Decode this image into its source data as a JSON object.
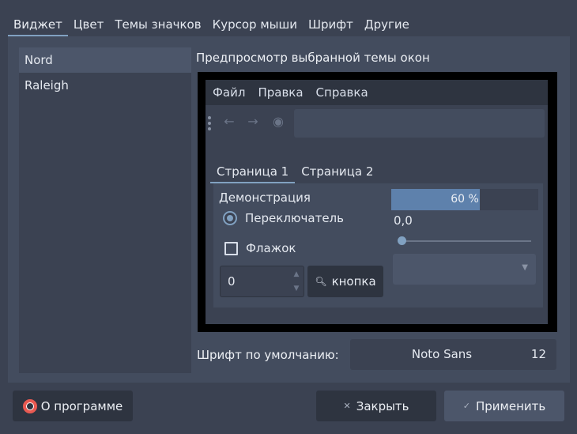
{
  "tabs": [
    "Виджет",
    "Цвет",
    "Темы значков",
    "Курсор мыши",
    "Шрифт",
    "Другие"
  ],
  "style_list": [
    "Nord",
    "Raleigh"
  ],
  "preview": {
    "label": "Предпросмотр выбранной темы окон",
    "menu": [
      "Файл",
      "Правка",
      "Справка"
    ],
    "toolbar_icons": [
      "back-arrow",
      "forward-arrow",
      "record"
    ],
    "tabs": [
      "Страница 1",
      "Страница 2"
    ],
    "group_title": "Демонстрация",
    "radio_label": "Переключатель",
    "checkbox_label": "Флажок",
    "spin_value": "0",
    "button_label": "кнопка",
    "progress": {
      "value": 60,
      "text": "60 %"
    },
    "slider_value": "0,0"
  },
  "default_font": {
    "label": "Шрифт по умолчанию:",
    "name": "Noto Sans",
    "size": "12"
  },
  "buttons": {
    "about": "О программе",
    "close": "Закрыть",
    "apply": "Применить"
  },
  "colors": {
    "accent": "#81a1c1",
    "background": "#3b4252",
    "panel": "#434c5e",
    "progress": "#5e81ac"
  }
}
